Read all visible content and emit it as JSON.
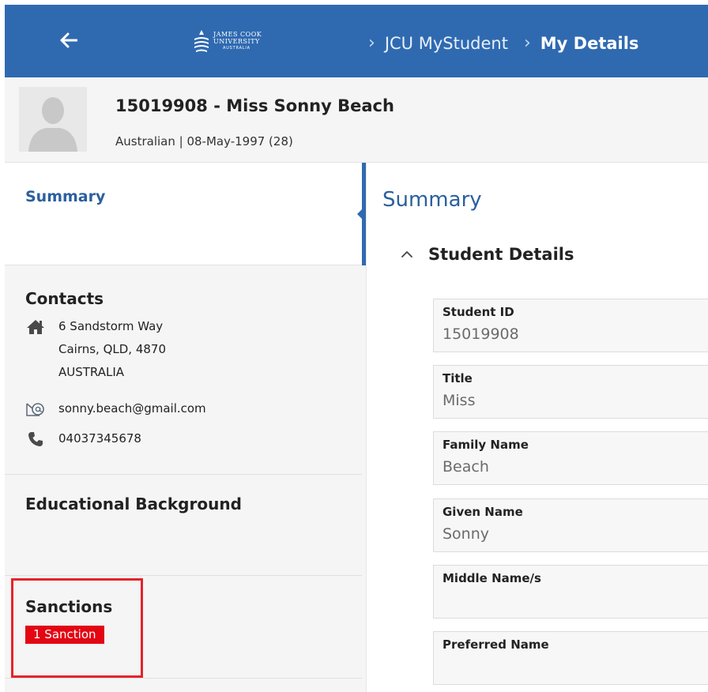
{
  "header": {
    "logo": {
      "line1": "JAMES COOK",
      "line2": "UNIVERSITY",
      "line3": "AUSTRALIA"
    },
    "breadcrumb": [
      "JCU MyStudent",
      "My Details"
    ],
    "bar_color": "#2f6ab1"
  },
  "profile": {
    "name": "15019908 - Miss Sonny Beach",
    "subline": "Australian | 08-May-1997 (28)"
  },
  "sidebar": {
    "summary_label": "Summary",
    "contacts": {
      "title": "Contacts",
      "address": [
        "6 Sandstorm Way",
        "Cairns, QLD, 4870",
        "AUSTRALIA"
      ],
      "email": "sonny.beach@gmail.com",
      "phone": "04037345678"
    },
    "education_title": "Educational Background",
    "sanctions": {
      "title": "Sanctions",
      "badge": "1 Sanction",
      "badge_color": "#e30613"
    }
  },
  "main": {
    "title": "Summary",
    "section_title": "Student Details",
    "fields": [
      {
        "label": "Student ID",
        "value": "15019908"
      },
      {
        "label": "Title",
        "value": "Miss"
      },
      {
        "label": "Family Name",
        "value": "Beach"
      },
      {
        "label": "Given Name",
        "value": "Sonny"
      },
      {
        "label": "Middle Name/s",
        "value": ""
      },
      {
        "label": "Preferred Name",
        "value": ""
      }
    ]
  },
  "icons": {
    "back": "arrow-left-icon",
    "address": "home-icon",
    "email": "email-at-icon",
    "phone": "phone-icon",
    "collapse": "chevron-up-icon"
  }
}
